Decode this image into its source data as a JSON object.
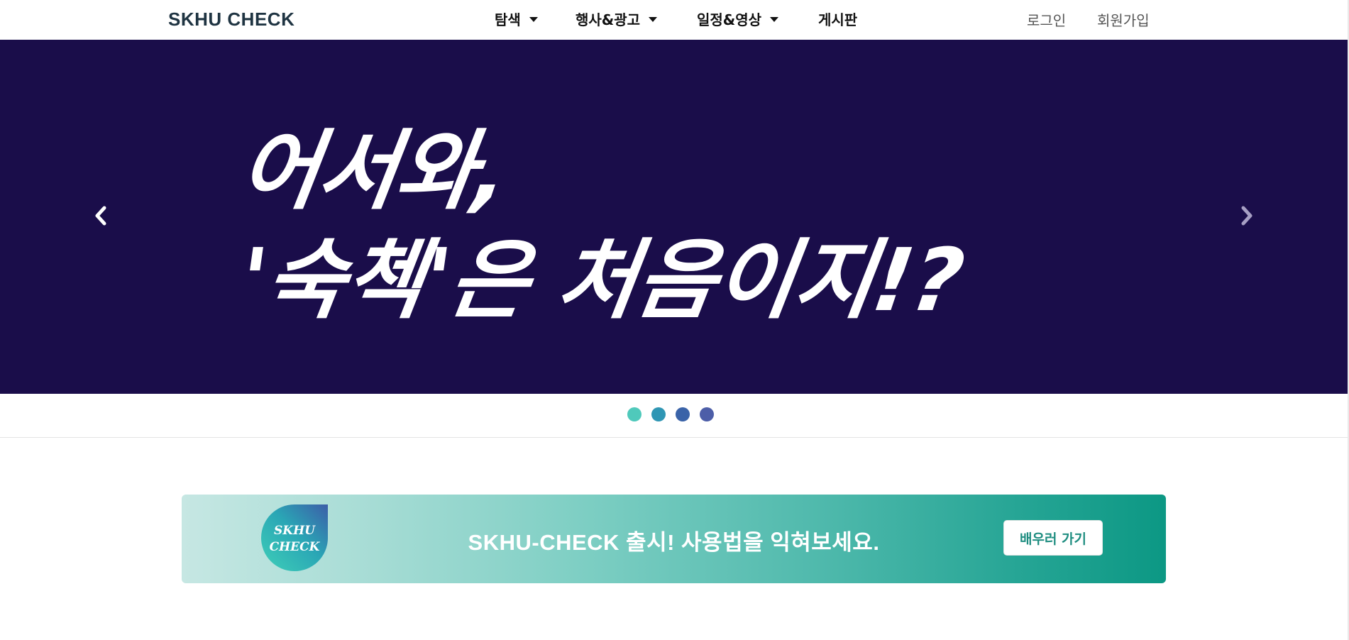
{
  "navbar": {
    "brand": "SKHU CHECK",
    "menu": [
      {
        "label": "탐색",
        "has_dropdown": true
      },
      {
        "label": "행사&광고",
        "has_dropdown": true
      },
      {
        "label": "일정&영상",
        "has_dropdown": true
      },
      {
        "label": "게시판",
        "has_dropdown": false
      }
    ],
    "login": "로그인",
    "signup": "회원가입"
  },
  "carousel": {
    "slide_line1": "어서와,",
    "slide_line2": "'숙첵'은 처음이지!?",
    "background_color": "#1a0d4a",
    "prev_icon": "chevron-left-icon",
    "next_icon": "chevron-right-icon",
    "indicator_colors": [
      "#4fc9bb",
      "#2f96b4",
      "#3a63a8",
      "#4d5ea8"
    ],
    "active_indicator": 1
  },
  "banner": {
    "logo_text_line1": "SKHU",
    "logo_text_line2": "CHECK",
    "message": "SKHU-CHECK 출시! 사용법을 익혀보세요.",
    "button_label": "배우러 가기"
  }
}
